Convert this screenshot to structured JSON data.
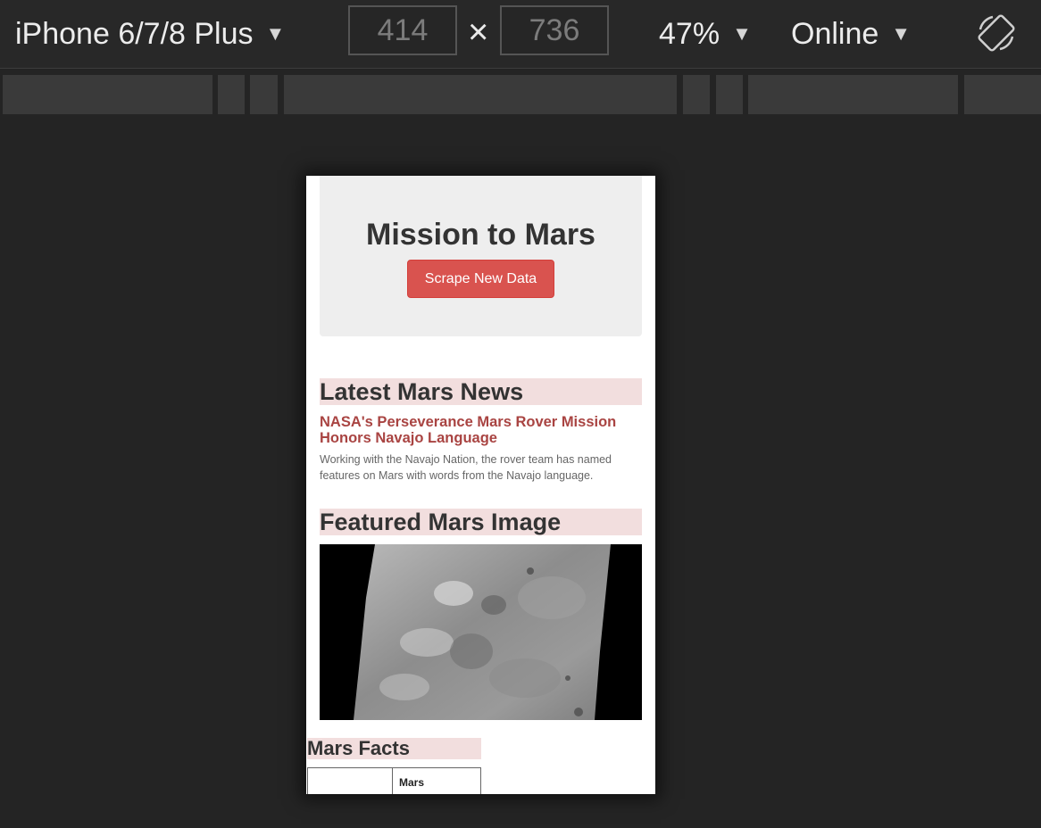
{
  "toolbar": {
    "device": "iPhone 6/7/8 Plus",
    "width": "414",
    "height": "736",
    "times": "×",
    "zoom": "47%",
    "network": "Online",
    "caret": "▼"
  },
  "page": {
    "title": "Mission to Mars",
    "scrape_button": "Scrape New Data",
    "news": {
      "heading": "Latest Mars News",
      "title": "NASA's Perseverance Mars Rover Mission Honors Navajo Language",
      "paragraph": "Working with the Navajo Nation, the rover team has named features on Mars with words from the Navajo language."
    },
    "image": {
      "heading": "Featured Mars Image"
    },
    "facts": {
      "heading": "Mars Facts",
      "columns": [
        "",
        "Mars"
      ]
    }
  },
  "colors": {
    "accent_button": "#d9534f",
    "section_bg": "#f2dede",
    "news_title": "#a94442"
  }
}
